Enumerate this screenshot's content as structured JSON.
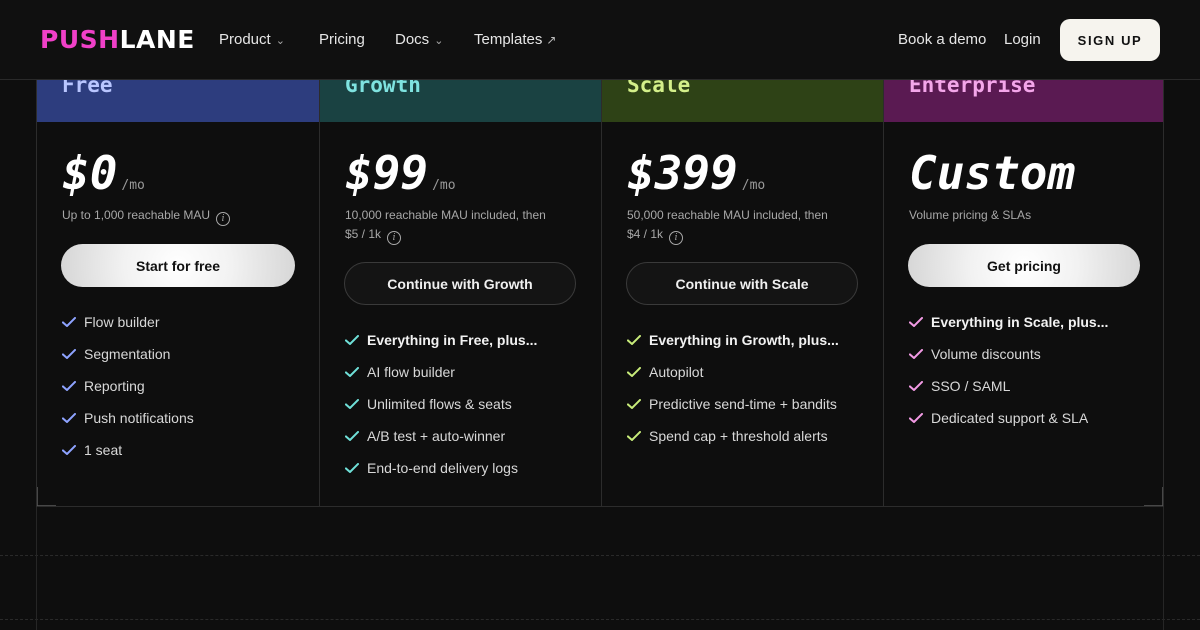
{
  "brand": {
    "logo_part1": "PUSH",
    "logo_part2": "LANE"
  },
  "nav": {
    "links": [
      {
        "label": "Product",
        "has_dropdown": true
      },
      {
        "label": "Pricing",
        "has_dropdown": false
      },
      {
        "label": "Docs",
        "has_dropdown": true
      },
      {
        "label": "Templates",
        "external": true
      }
    ],
    "dropdown_icon": "⌄",
    "external_icon": "↗",
    "book_demo": "Book a demo",
    "login": "Login",
    "signup": "SIGN UP"
  },
  "plans": [
    {
      "title": "Free",
      "header_color": "#2d3d7e",
      "title_color": "#b9c6ff",
      "check_color": "#8ea3ff",
      "price": "$0",
      "period": "/mo",
      "description": "Up to 1,000 reachable MAU",
      "description_line2": "",
      "button": "Start for free",
      "button_style": "light",
      "features": [
        "Flow builder",
        "Segmentation",
        "Reporting",
        "Push notifications",
        "1 seat"
      ],
      "first_feature_bold": false
    },
    {
      "title": "Growth",
      "header_color": "#1a4242",
      "title_color": "#7fe3e0",
      "check_color": "#6fe0d8",
      "price": "$99",
      "period": "/mo",
      "description": "10,000 reachable MAU included, then",
      "description_line2": "$5 / 1k",
      "button": "Continue with Growth",
      "button_style": "dark",
      "features": [
        "Everything in Free, plus...",
        "AI flow builder",
        "Unlimited flows & seats",
        "A/B test + auto-winner",
        "End-to-end delivery logs"
      ],
      "first_feature_bold": true
    },
    {
      "title": "Scale",
      "header_color": "#2e4216",
      "title_color": "#d4f08a",
      "check_color": "#c8ec7a",
      "price": "$399",
      "period": "/mo",
      "description": "50,000 reachable MAU included, then",
      "description_line2": "$4 / 1k",
      "button": "Continue with Scale",
      "button_style": "dark",
      "features": [
        "Everything in Growth, plus...",
        "Autopilot",
        "Predictive send-time + bandits",
        "Spend cap + threshold alerts"
      ],
      "first_feature_bold": true
    },
    {
      "title": "Enterprise",
      "header_color": "#5a1a52",
      "title_color": "#f4a6ea",
      "check_color": "#f29ae4",
      "price": "Custom",
      "period": "",
      "description": "Volume pricing & SLAs",
      "description_line2": "",
      "button": "Get pricing",
      "button_style": "light",
      "features": [
        "Everything in Scale, plus...",
        "Volume discounts",
        "SSO / SAML",
        "Dedicated support & SLA"
      ],
      "first_feature_bold": true
    }
  ],
  "icons": {
    "info": "i",
    "check": "check-icon"
  }
}
